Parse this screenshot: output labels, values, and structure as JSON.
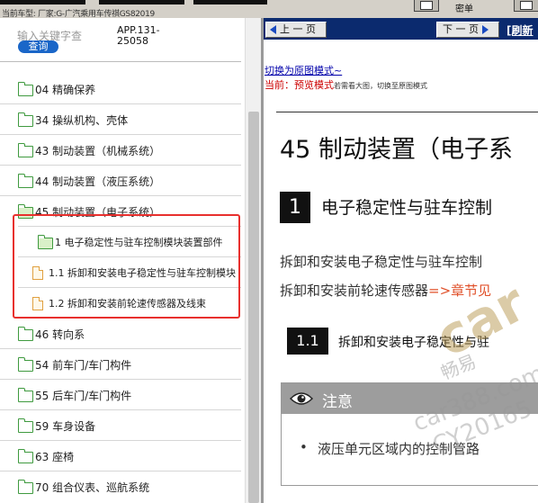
{
  "top_bar": {
    "car_info": "当前车型:   厂家:G-广汽乘用车传祺GS82019",
    "menu_label": "密单"
  },
  "search": {
    "placeholder": "输入关键字查",
    "button_label": "查询",
    "app_code": "APP.131-25058"
  },
  "tree": [
    {
      "label": "04 精确保养",
      "kind": "folder"
    },
    {
      "label": "34 操纵机构、壳体",
      "kind": "folder"
    },
    {
      "label": "43 制动装置（机械系统）",
      "kind": "folder"
    },
    {
      "label": "44 制动装置（液压系统）",
      "kind": "folder"
    },
    {
      "label": "45 制动装置（电子系统）",
      "kind": "folder-open"
    },
    {
      "label": "1 电子稳定性与驻车控制模块装置部件",
      "kind": "folder-open"
    },
    {
      "label": "1.1 拆卸和安装电子稳定性与驻车控制模块",
      "kind": "doc"
    },
    {
      "label": "1.2 拆卸和安装前轮速传感器及线束",
      "kind": "doc"
    },
    {
      "label": "46 转向系",
      "kind": "folder"
    },
    {
      "label": "54 前车门/车门构件",
      "kind": "folder"
    },
    {
      "label": "55 后车门/车门构件",
      "kind": "folder"
    },
    {
      "label": "59 车身设备",
      "kind": "folder"
    },
    {
      "label": "63 座椅",
      "kind": "folder"
    },
    {
      "label": "70 组合仪表、巡航系统",
      "kind": "folder"
    }
  ],
  "viewer": {
    "prev_label": "上 一 页",
    "next_label": "下 一 页",
    "refresh_label": "[刷新",
    "switch_link": "切换为原图模式~",
    "current_prefix": "当前：",
    "current_mode": "预览模式",
    "current_hint": "若需看大图，切换至原图模式",
    "title": "45 制动装置（电子系",
    "section_num": "1",
    "section_title": "电子稳定性与驻车控制",
    "para1": "拆卸和安装电子稳定性与驻车控制",
    "para2_text": "拆卸和安装前轮速传感器",
    "para2_ref": "=>章节见",
    "sub_num": "1.1",
    "sub_title": "拆卸和安装电子稳定性与驻",
    "note_title": "注意",
    "note_bullet": "液压单元区域内的控制管路"
  },
  "watermark": {
    "line1": "car",
    "line2": "畅易",
    "line3": "car388.com",
    "line4": "CY20165"
  },
  "colors": {
    "highlight_border": "#e8302e",
    "nav_bar": "#0b2a6e",
    "query_button": "#1a66c8",
    "mode_text": "#cc0000"
  }
}
